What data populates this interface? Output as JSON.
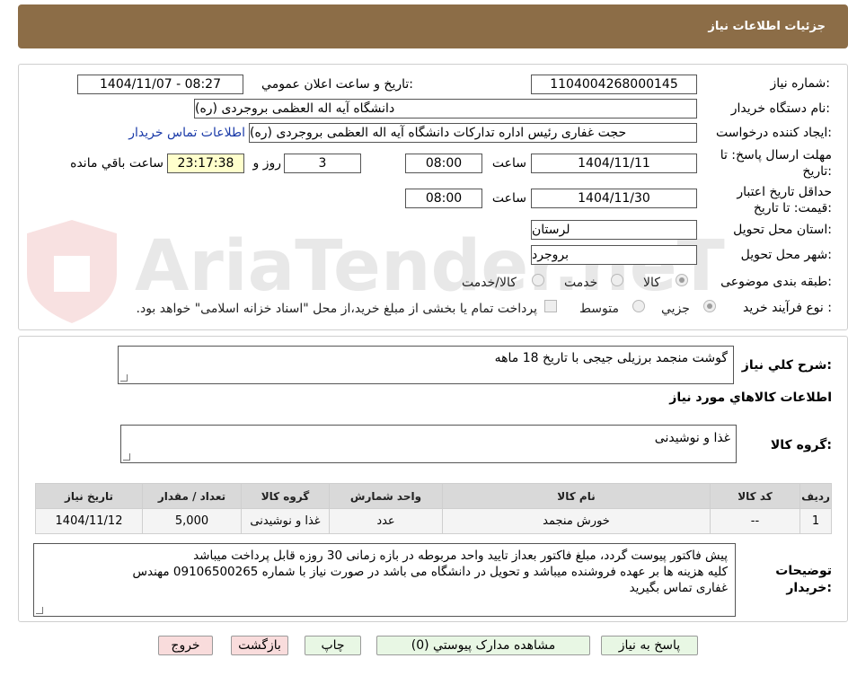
{
  "header": {
    "title": "جزئیات اطلاعات نیاز"
  },
  "watermark": {
    "text": "AriaTender.neT"
  },
  "form": {
    "need_number_label": "شماره نیاز:",
    "need_number": "1104004268000145",
    "announce_label": "تاریخ و ساعت اعلان عمومي:",
    "announce_value": "1404/11/07 - 08:27",
    "buyer_org_label": "نام دستگاه خريدار:",
    "buyer_org": "دانشگاه آیه اله العظمی بروجردی (ره)",
    "requester_label": "ایجاد کننده درخواست:",
    "requester": "حجت غفاری رئیس اداره تدارکات  دانشگاه آیه اله العظمی بروجردی (ره)",
    "contact_link": "اطلاعات تماس خريدار",
    "reply_deadline_label_1": "مهلت ارسال پاسخ: تا",
    "reply_deadline_label_2": "تاریخ:",
    "reply_date": "1404/11/11",
    "time_label": "ساعت",
    "reply_time": "08:00",
    "days_value": "3",
    "days_label": "روز و",
    "remaining_value": "23:17:38",
    "remaining_label": "ساعت باقي مانده",
    "price_validity_label_1": "حداقل تاریخ اعتبار",
    "price_validity_label_2": "قیمت: تا تاریخ:",
    "price_validity_date": "1404/11/30",
    "price_validity_time": "08:00",
    "province_label": "استان محل تحویل:",
    "province": "لرستان",
    "city_label": "شهر محل تحویل:",
    "city": "بروجرد",
    "category_label": "طبقه بندی موضوعی:",
    "category_options": [
      "کالا",
      "خدمت",
      "کالا/خدمت"
    ],
    "category_selected": "کالا",
    "process_label": "نوع فرآیند خرید :",
    "process_options": [
      "جزیي",
      "متوسط"
    ],
    "process_selected": "جزیي",
    "payment_note": "پرداخت تمام یا بخشی از مبلغ خرید،از محل \"اسناد خزانه اسلامی\" خواهد بود."
  },
  "summary": {
    "label": "شرح کلي نياز:",
    "value": "گوشت منجمد برزیلی جیجی با تاریخ 18 ماهه"
  },
  "goods": {
    "section_title": "اطلاعات کالاهاي مورد نياز",
    "group_label": "گروه کالا:",
    "group_value": "غذا و نوشیدنی",
    "columns": [
      "رديف",
      "کد کالا",
      "نام کالا",
      "واحد شمارش",
      "گروه کالا",
      "تعداد / مقدار",
      "تاريخ نياز"
    ],
    "rows": [
      [
        "1",
        "--",
        "خورش منجمد",
        "عدد",
        "غذا و نوشیدنی",
        "5,000",
        "1404/11/12"
      ]
    ]
  },
  "notes": {
    "label_1": "توضيحات",
    "label_2": "خريدار:",
    "lines": [
      "پیش فاکتور پیوست گردد، مبلغ فاکتور بعداز تایید واحد مربوطه در بازه زمانی 30 روزه قابل پرداخت میباشد",
      "کلیه هزینه ها بر عهده فروشنده میباشد و تحویل در دانشگاه می باشد در صورت نیاز با شماره 09106500265 مهندس",
      "غفاری تماس بگیرید"
    ]
  },
  "buttons": {
    "reply": "پاسخ به نياز",
    "attachments": "مشاهده مدارک پيوستي (0)",
    "print": "چاپ",
    "back": "بازگشت",
    "exit": "خروج"
  },
  "colors": {
    "header_bg": "#8c6d47",
    "link": "#1a3aa8",
    "remaining_bg": "#ffffcc",
    "button_green": "#e8f7e4",
    "button_pink": "#f9dcdc"
  }
}
